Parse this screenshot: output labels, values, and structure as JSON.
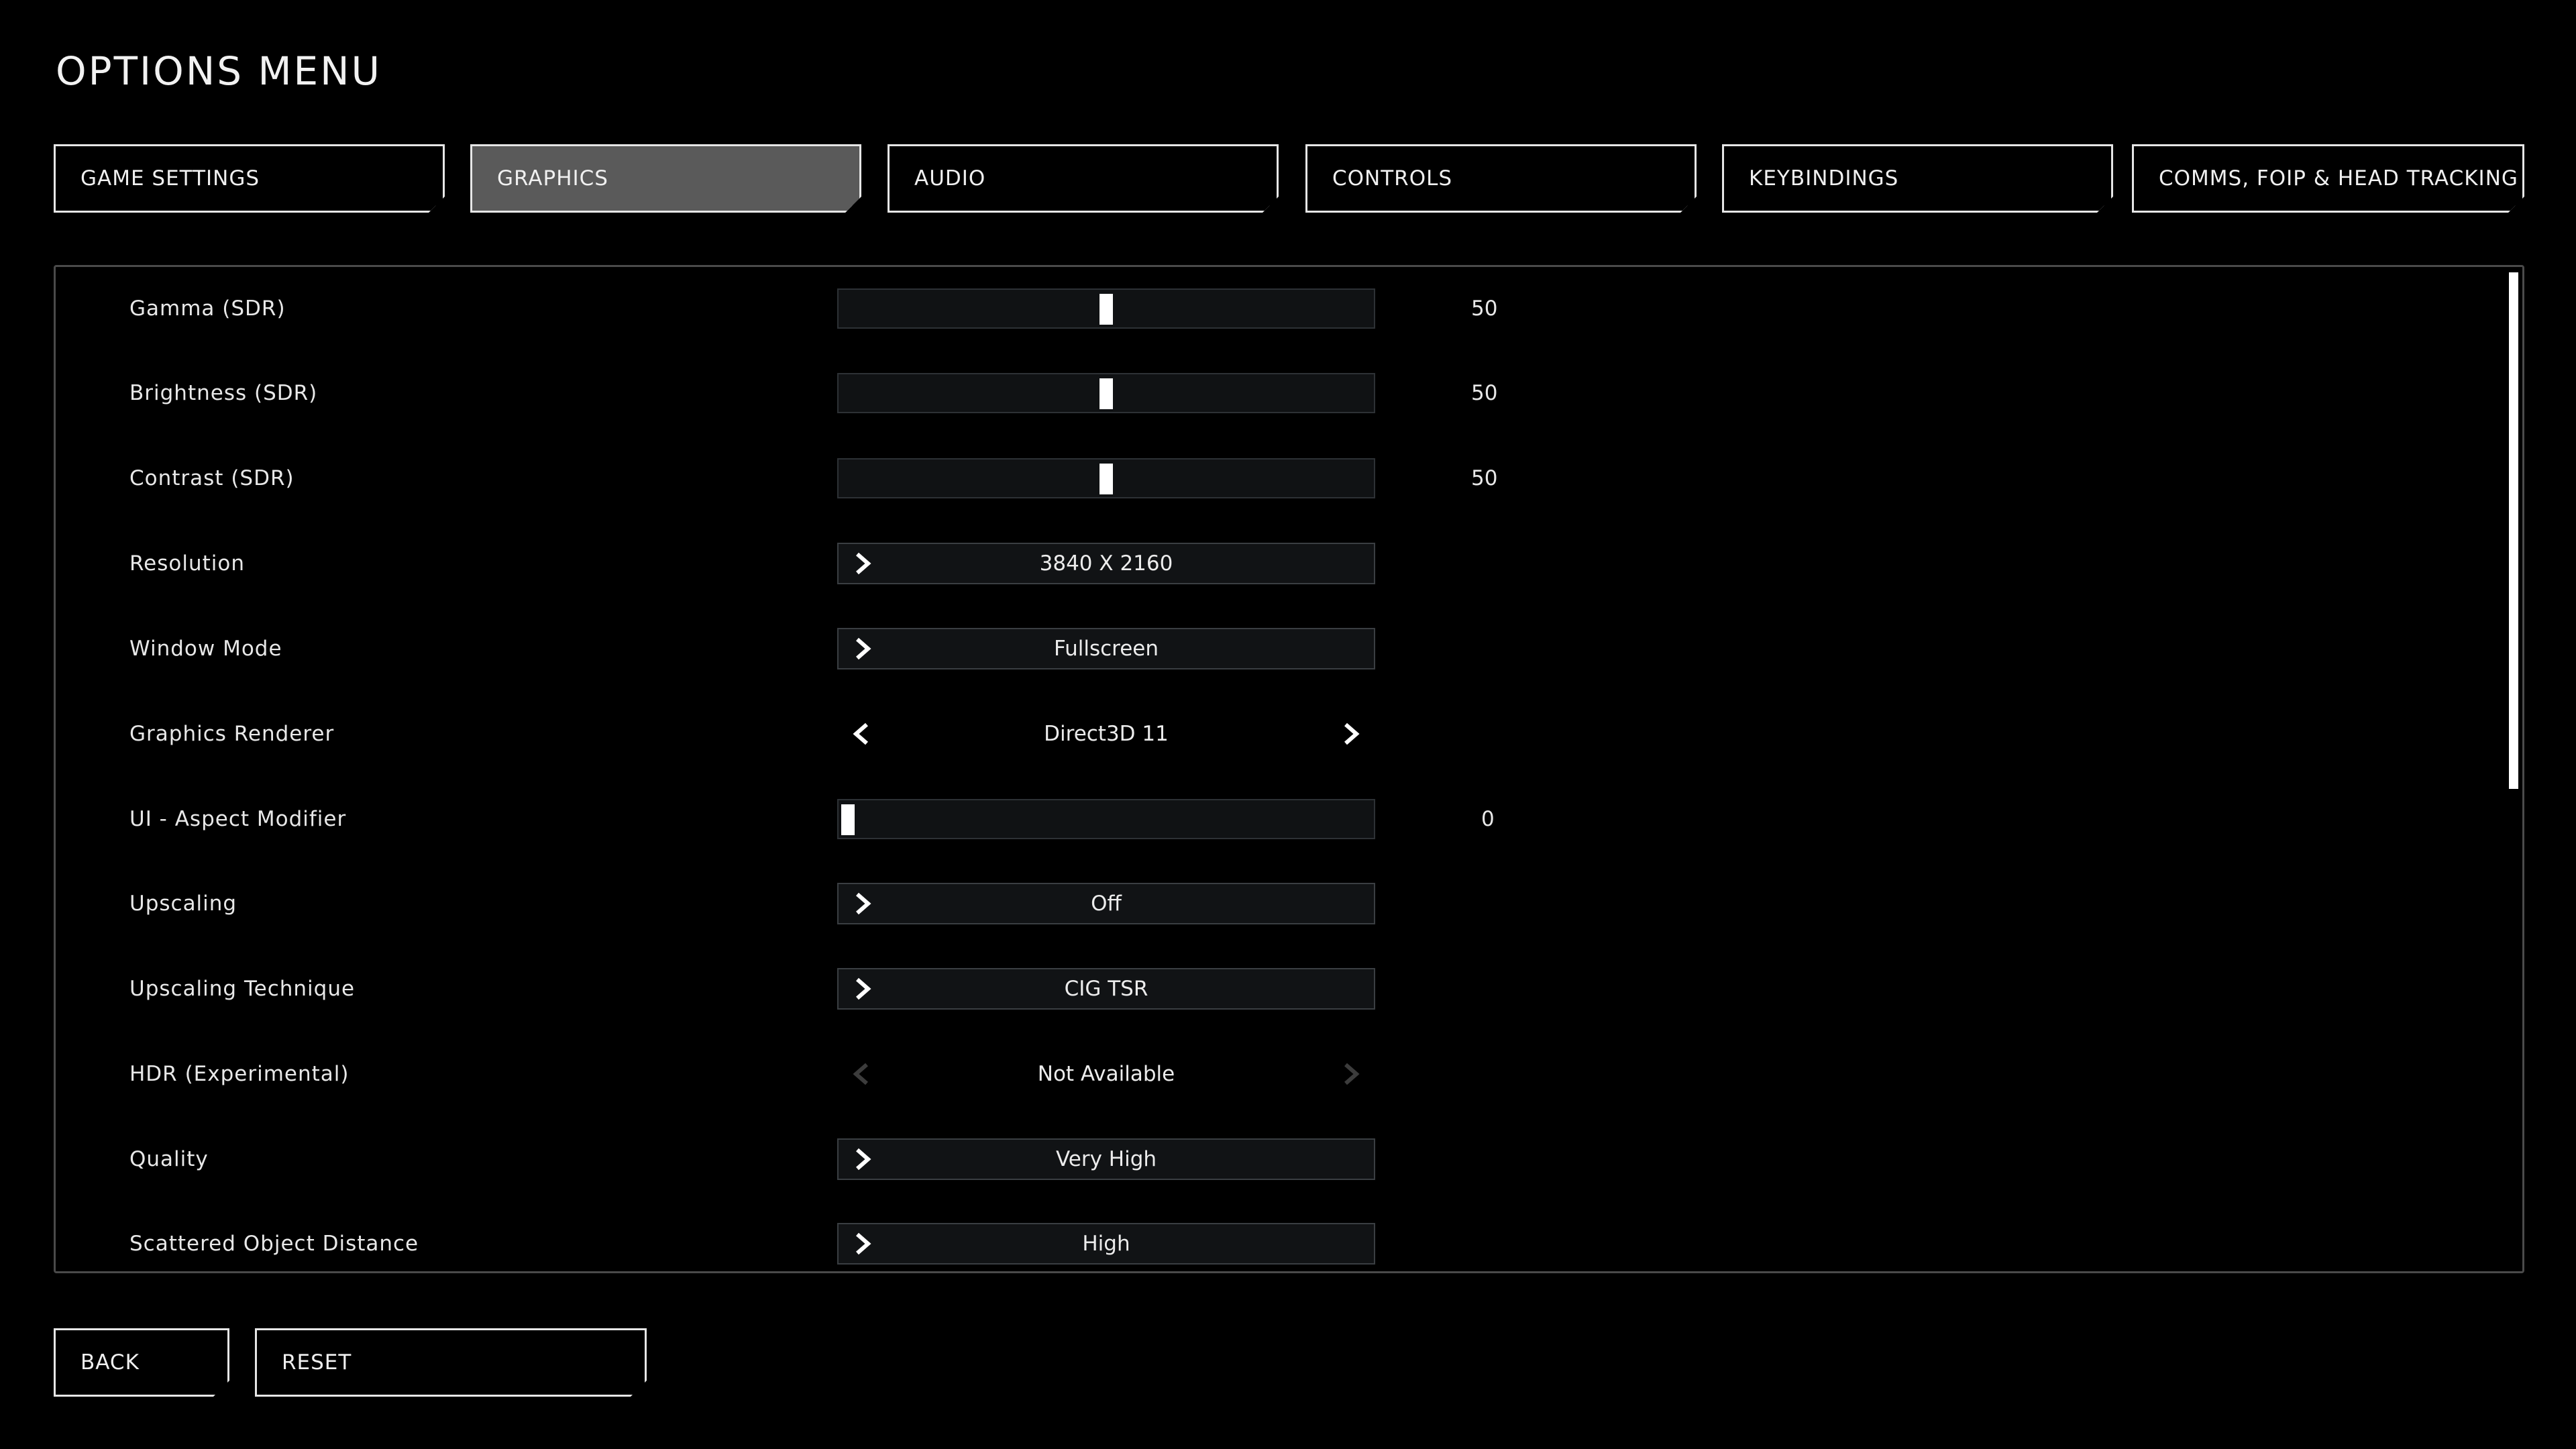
{
  "title": "OPTIONS MENU",
  "tabs": [
    {
      "label": "GAME SETTINGS",
      "active": false
    },
    {
      "label": "GRAPHICS",
      "active": true
    },
    {
      "label": "AUDIO",
      "active": false
    },
    {
      "label": "CONTROLS",
      "active": false
    },
    {
      "label": "KEYBINDINGS",
      "active": false
    },
    {
      "label": "COMMS, FOIP & HEAD TRACKING",
      "active": false
    }
  ],
  "settings": [
    {
      "label": "Gamma (SDR)",
      "type": "slider",
      "value": "50",
      "level": 0.5
    },
    {
      "label": "Brightness (SDR)",
      "type": "slider",
      "value": "50",
      "level": 0.5
    },
    {
      "label": "Contrast (SDR)",
      "type": "slider",
      "value": "50",
      "level": 0.5
    },
    {
      "label": "Resolution",
      "type": "dropdown",
      "value": "3840 X 2160"
    },
    {
      "label": "Window Mode",
      "type": "dropdown",
      "value": "Fullscreen"
    },
    {
      "label": "Graphics Renderer",
      "type": "cycler",
      "value": "Direct3D 11",
      "enabled": true
    },
    {
      "label": "UI - Aspect Modifier",
      "type": "slider",
      "value": "0",
      "level": 0.0
    },
    {
      "label": "Upscaling",
      "type": "dropdown",
      "value": "Off"
    },
    {
      "label": "Upscaling Technique",
      "type": "dropdown",
      "value": "CIG TSR"
    },
    {
      "label": "HDR (Experimental)",
      "type": "cycler",
      "value": "Not Available",
      "enabled": false
    },
    {
      "label": "Quality",
      "type": "dropdown",
      "value": "Very High"
    },
    {
      "label": "Scattered Object Distance",
      "type": "dropdown",
      "value": "High"
    }
  ],
  "scroll": {
    "visible_fraction": 0.52
  },
  "buttons": {
    "back": "BACK",
    "reset": "RESET"
  },
  "icons": {
    "dropdown": "chevron-right-icon",
    "cycle_left": "chevron-left-icon",
    "cycle_right": "chevron-right-icon"
  },
  "colors": {
    "background": "#000000",
    "tab_active": "#5a5a5a",
    "border": "#e6e6e6",
    "control_bg": "#111315"
  }
}
